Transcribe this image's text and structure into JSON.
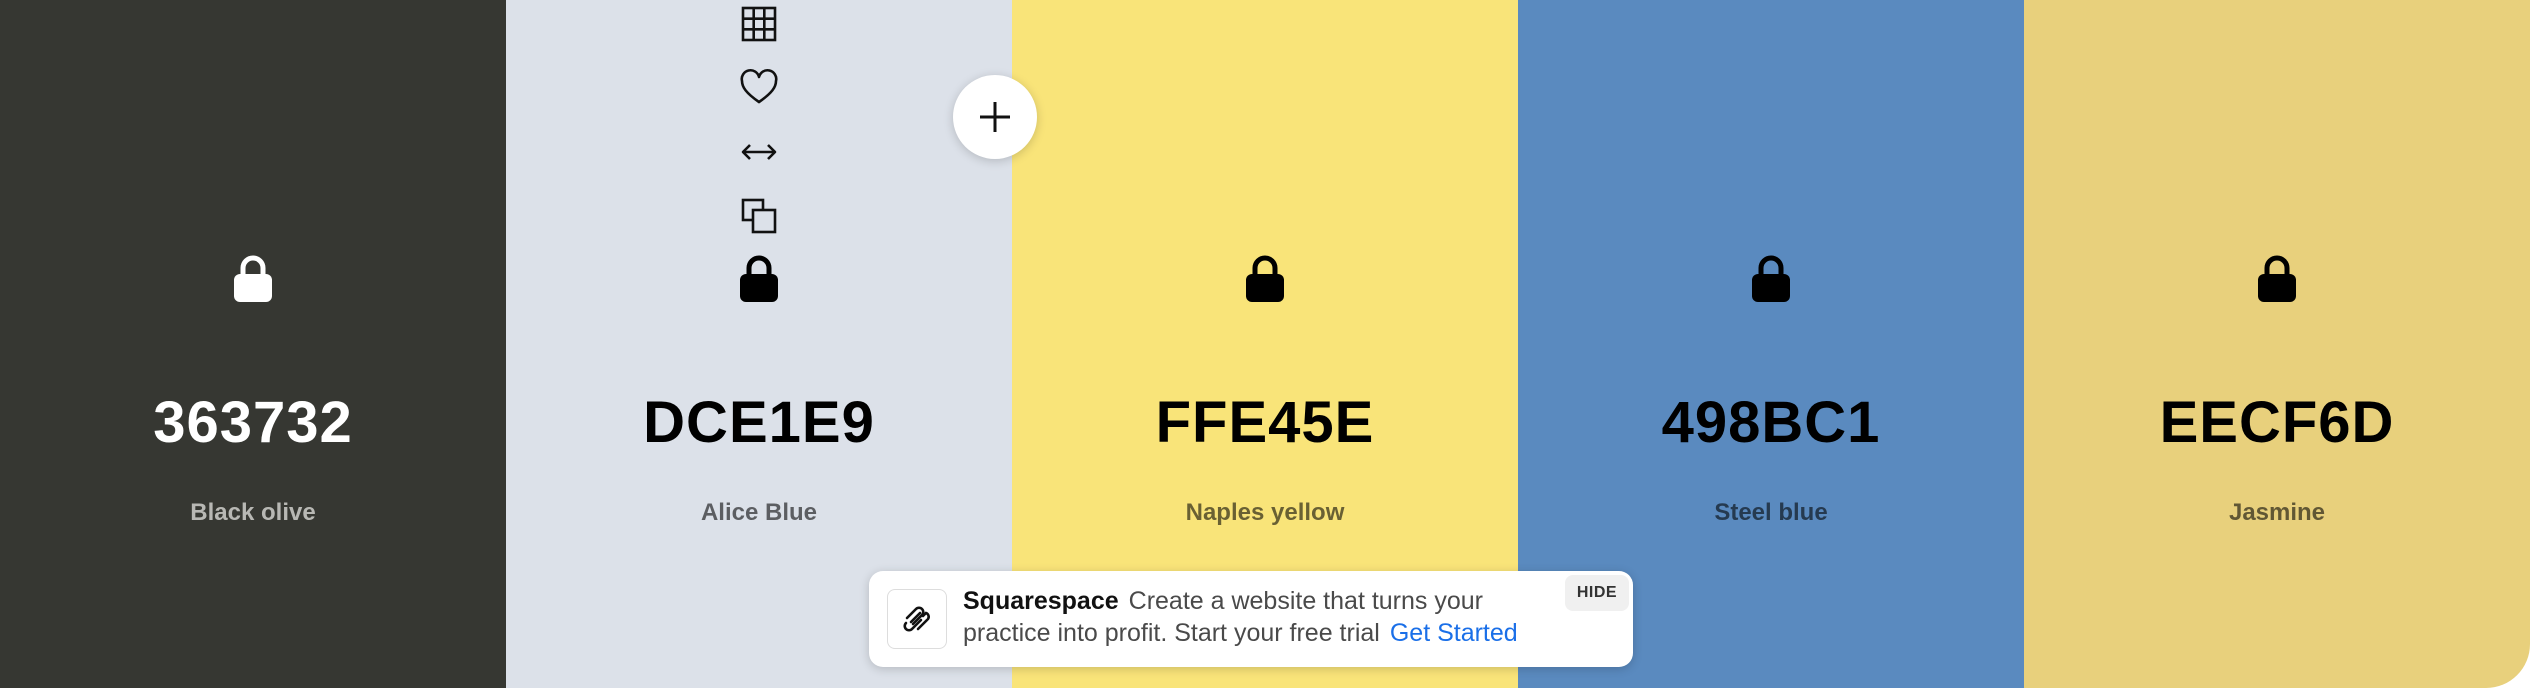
{
  "palette": {
    "colors": [
      {
        "hex": "363732",
        "name": "Black olive",
        "bg": "#363732",
        "tone": "dark"
      },
      {
        "hex": "DCE1E9",
        "name": "Alice Blue",
        "bg": "#DCE1E9",
        "tone": "light"
      },
      {
        "hex": "FFE45E",
        "name": "Naples yellow",
        "bg": "#F9E479",
        "tone": "light"
      },
      {
        "hex": "498BC1",
        "name": "Steel blue",
        "bg": "#5A8ABF",
        "tone": "light"
      },
      {
        "hex": "EECF6D",
        "name": "Jasmine",
        "bg": "#E8D07C",
        "tone": "light"
      }
    ],
    "hover_tools": [
      "grid-icon",
      "heart-icon",
      "arrows-horizontal-icon",
      "copy-icon"
    ],
    "add_button_icon": "plus-icon"
  },
  "ad": {
    "brand": "Squarespace",
    "line": "Create a website that turns your practice into profit. Start your free trial",
    "cta": "Get Started",
    "hide_label": "HIDE",
    "logo_icon": "squarespace-logo"
  }
}
